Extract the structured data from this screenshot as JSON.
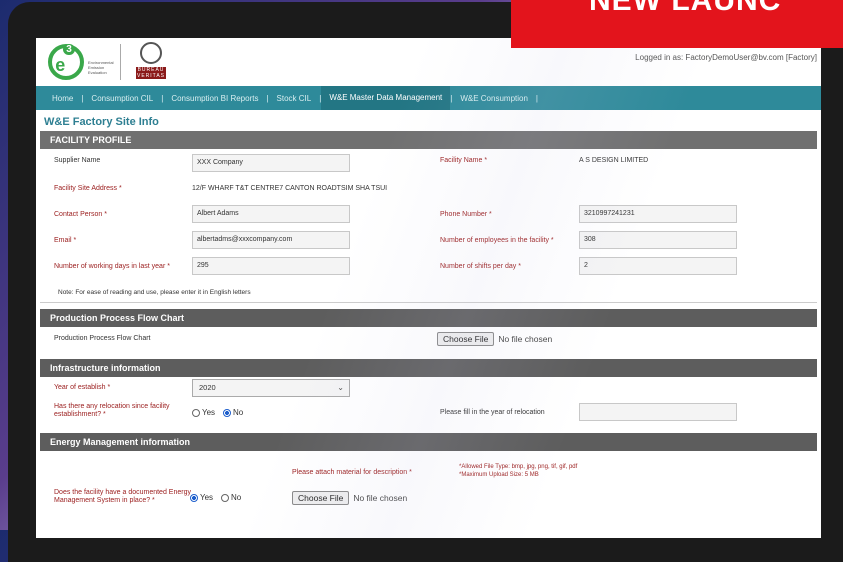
{
  "banner": {
    "text": "NEW LAUNC"
  },
  "header": {
    "logo_text": "e",
    "logo_sup": "3",
    "logo_sub": "Environmental Emission Evaluation",
    "bv_text": "BUREAU VERITAS",
    "login": "Logged in as: FactoryDemoUser@bv.com [Factory]"
  },
  "nav": {
    "items": [
      "Home",
      "Consumption CIL",
      "Consumption BI Reports",
      "Stock CIL",
      "W&E Master Data Management",
      "W&E Consumption"
    ]
  },
  "page": {
    "title": "W&E Factory Site Info"
  },
  "facility_profile": {
    "heading": "FACILITY PROFILE",
    "supplier_name_label": "Supplier Name",
    "supplier_name_value": "XXX Company",
    "facility_name_label": "Facility Name *",
    "facility_name_value": "A S DESIGN LIMITED",
    "address_label": "Facility Site Address *",
    "address_value": "12/F WHARF T&T CENTRE7 CANTON ROADTSIM SHA TSUI",
    "contact_label": "Contact Person *",
    "contact_value": "Albert Adams",
    "phone_label": "Phone Number *",
    "phone_value": "3210997241231",
    "email_label": "Email *",
    "email_value": "albertadms@xxxcompany.com",
    "employees_label": "Number of employees in the facility *",
    "employees_value": "308",
    "working_days_label": "Number of working days in last year *",
    "working_days_value": "295",
    "shifts_label": "Number of shifts per day *",
    "shifts_value": "2",
    "note": "Note: For ease of reading and use, please enter it in English letters"
  },
  "production": {
    "heading": "Production Process Flow Chart",
    "label": "Production Process Flow Chart",
    "choose_file": "Choose File",
    "no_file": "No file chosen"
  },
  "infrastructure": {
    "heading": "Infrastructure information",
    "year_label": "Year of establish *",
    "year_value": "2020",
    "relocation_label": "Has there any relocation since facility establishment? *",
    "yes": "Yes",
    "no": "No",
    "relocation_year_label": "Please fill in the year of relocation"
  },
  "energy": {
    "heading": "Energy Management information",
    "attach_label": "Please attach material for description *",
    "allowed_types": "*Allowed File Type: bmp, jpg, png, tif, gif, pdf",
    "max_size": "*Maximum Upload Size: 5 MB",
    "ems_label": "Does the facility have a documented Energy Management System in place? *",
    "yes": "Yes",
    "no": "No",
    "choose_file": "Choose File",
    "no_file": "No file chosen"
  }
}
